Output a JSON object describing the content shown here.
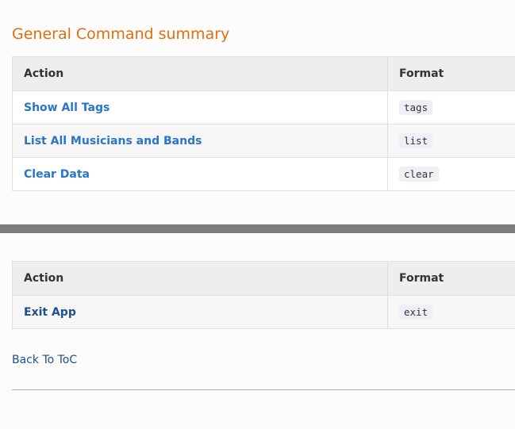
{
  "section": {
    "title": "General Command summary"
  },
  "table_top": {
    "headers": {
      "action": "Action",
      "format": "Format"
    },
    "rows": [
      {
        "action": "Show All Tags",
        "format": "tags"
      },
      {
        "action": "List All Musicians and Bands",
        "format": "list"
      },
      {
        "action": "Clear Data",
        "format": "clear"
      }
    ]
  },
  "table_bottom": {
    "headers": {
      "action": "Action",
      "format": "Format"
    },
    "rows": [
      {
        "action": "Exit App",
        "format": "exit"
      }
    ]
  },
  "footer": {
    "back_link": "Back To ToC"
  },
  "colors": {
    "title": "#e46c0a",
    "link_top": "#2a74c9",
    "link_bottom": "#1f4f8f",
    "separator": "#7c7c7c"
  }
}
